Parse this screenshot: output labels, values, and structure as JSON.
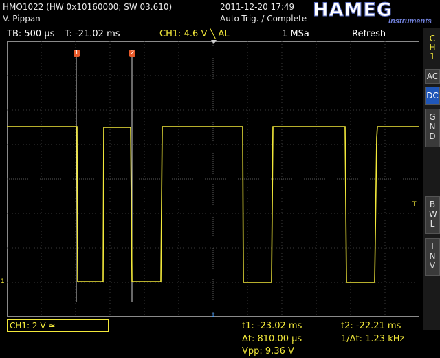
{
  "header": {
    "device": "HMO1022 (HW 0x10160000; SW 03.610)",
    "user": "V. Pippan",
    "datetime": "2011-12-20 17:49",
    "trigger_status": "Auto-Trig. / Complete",
    "logo_word": "HAMEG",
    "logo_sub": "Instruments"
  },
  "infobar": {
    "timebase": "TB: 500 µs",
    "trigger_time": "T: -21.02 ms",
    "channel_trigger": "CH1: 4.6 V ╲ AL",
    "sample_rate": "1 MSa",
    "mode": "Refresh"
  },
  "side_panel": {
    "channel_label": "CH1",
    "buttons": [
      {
        "label": "AC",
        "active": false
      },
      {
        "label": "DC",
        "active": true
      },
      {
        "label": "GND",
        "active": false
      },
      {
        "label": "BWL",
        "active": false
      },
      {
        "label": "INV",
        "active": false
      }
    ]
  },
  "cursors": {
    "c1_label": "1",
    "c2_label": "2"
  },
  "markers": {
    "trigger_level": "T",
    "ground": "1"
  },
  "bottom": {
    "channel_setting": "CH1: 2 V ≃",
    "t1": "t1: -23.02 ms",
    "t2": "t2: -22.21 ms",
    "delta_t": "Δt: 810.00 µs",
    "inv_delta_t": "1/Δt: 1.23 kHz",
    "vpp": "Vpp: 9.36 V"
  },
  "colors": {
    "trace": "#f2e83a",
    "cursor": "#e85a2a",
    "active_button": "#1f56b8"
  }
}
